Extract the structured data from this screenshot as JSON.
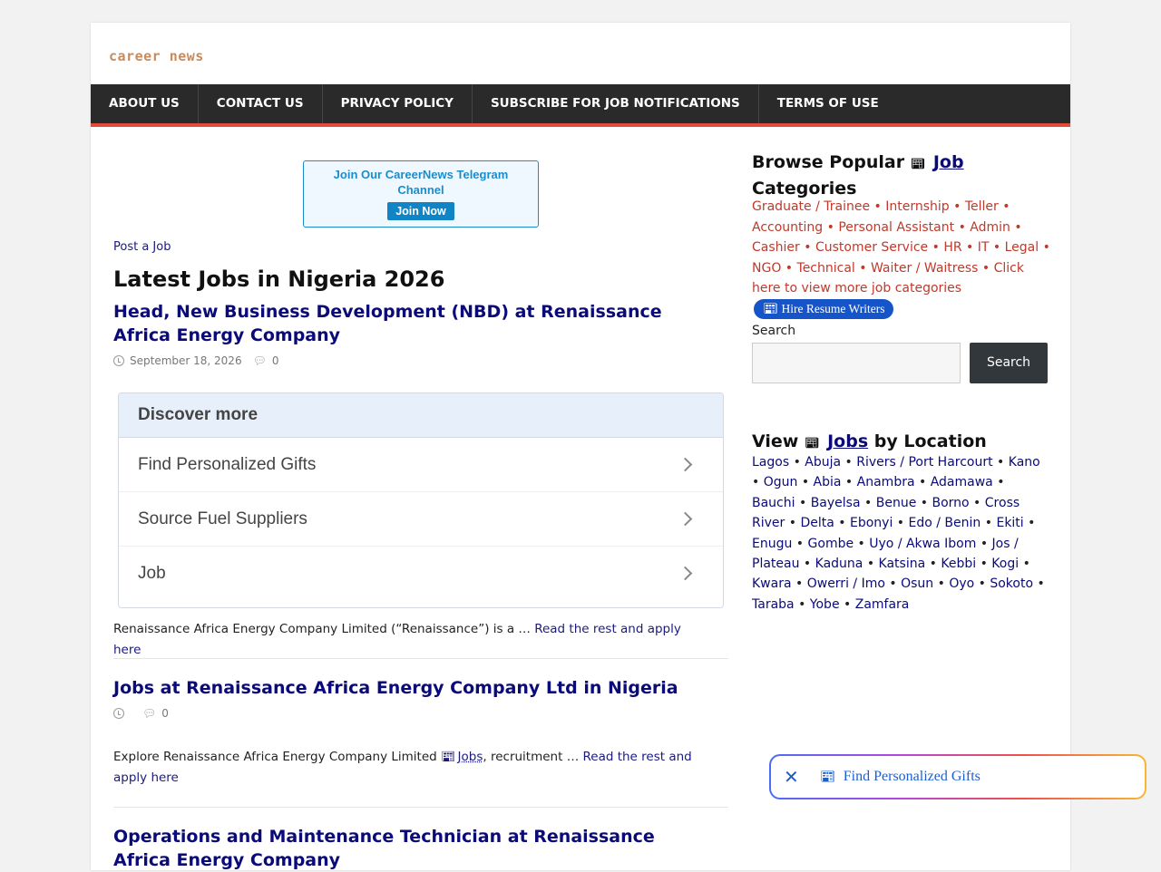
{
  "site": {
    "logo_text": "career news"
  },
  "nav": [
    "ABOUT US",
    "CONTACT US",
    "PRIVACY POLICY",
    "SUBSCRIBE FOR JOB NOTIFICATIONS",
    "TERMS OF USE"
  ],
  "telegram": {
    "text": "Join Our CareerNews Telegram Channel",
    "button": "Join Now"
  },
  "post_job": "Post a Job",
  "main_title": "Latest Jobs in Nigeria 2026",
  "posts": [
    {
      "title": "Head, New Business Development (NBD) at Renaissance Africa Energy Company",
      "date": "September 18, 2026",
      "comments": "0",
      "excerpt": "Renaissance Africa Energy Company Limited (“Renaissance”) is a …",
      "more": "Read the rest and apply here"
    },
    {
      "title": "Jobs at Renaissance Africa Energy Company Ltd in Nigeria",
      "date": "",
      "comments": "0",
      "excerpt_pre": "Explore Renaissance Africa Energy Company Limited",
      "excerpt_link": "Jobs",
      "excerpt_post": ", recruitment …",
      "more": "Read the rest and apply here"
    },
    {
      "title": "Operations and Maintenance Technician at Renaissance Africa Energy Company"
    }
  ],
  "discover": {
    "heading": "Discover more",
    "items": [
      "Find Personalized Gifts",
      "Source Fuel Suppliers",
      "Job"
    ]
  },
  "sidebar": {
    "categories_title_pre": "Browse Popular",
    "categories_title_link": "Job",
    "categories_title_post": "Categories",
    "categories": [
      "Graduate / Trainee",
      "Internship",
      "Teller",
      "Accounting",
      "Personal Assistant",
      "Admin",
      "Cashier",
      "Customer Service",
      "HR",
      "IT",
      "Legal",
      "NGO",
      "Technical",
      "Waiter / Waitress",
      "Click here to view more job categories"
    ],
    "resume_button": "Hire Resume Writers",
    "search_label": "Search",
    "search_button": "Search",
    "locations_title_pre": "View",
    "locations_title_link": "Jobs",
    "locations_title_post": "by Location",
    "locations": [
      "Lagos",
      "Abuja",
      "Rivers / Port Harcourt",
      "Kano",
      "Ogun",
      "Abia",
      "Anambra",
      "Adamawa",
      "Bauchi",
      "Bayelsa",
      "Benue",
      "Borno",
      "Cross River",
      "Delta",
      "Ebonyi",
      "Edo / Benin",
      "Ekiti",
      "Enugu",
      "Gombe",
      "Uyo / Akwa Ibom",
      "Jos / Plateau",
      "Kaduna",
      "Katsina",
      "Kebbi",
      "Kogi",
      "Kwara",
      "Owerri / Imo",
      "Osun",
      "Oyo",
      "Sokoto",
      "Taraba",
      "Yobe",
      "Zamfara"
    ]
  },
  "floating_bar": {
    "close": "✕",
    "text": "Find Personalized Gifts"
  }
}
